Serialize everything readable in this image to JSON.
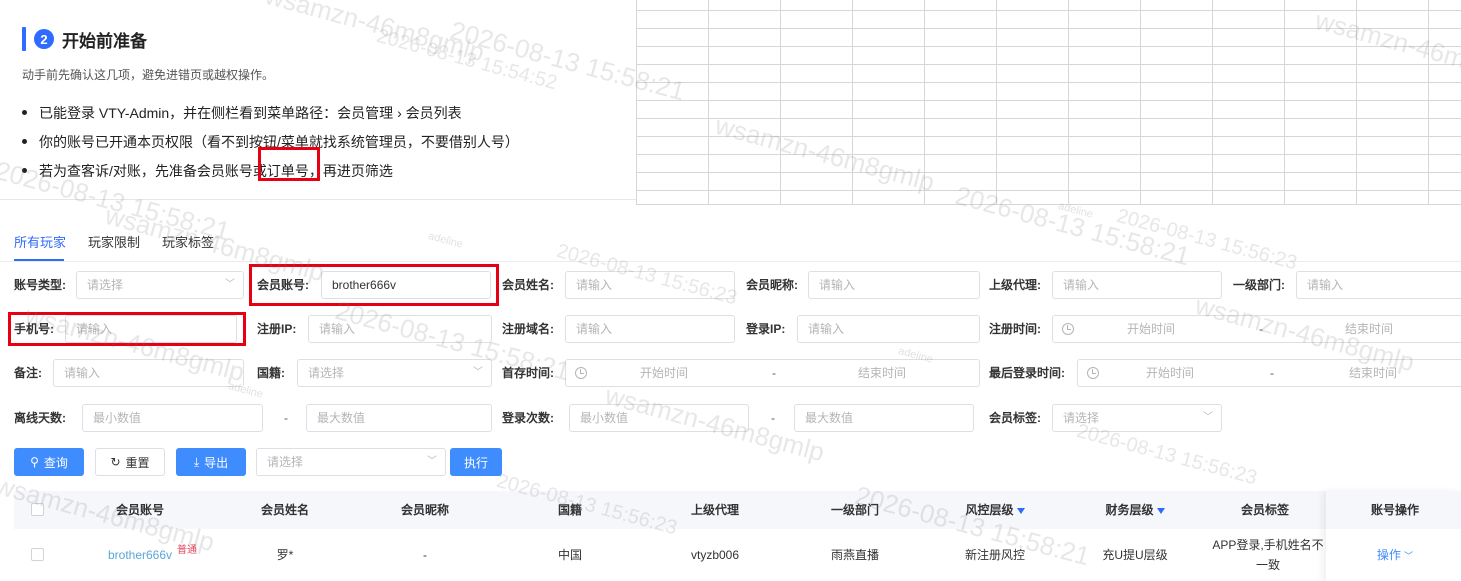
{
  "doc": {
    "step_number": "2",
    "title": "开始前准备",
    "subtitle": "动手前先确认这几项，避免进错页或越权操作。",
    "bullets": [
      "已能登录 VTY-Admin，并在侧栏看到菜单路径：会员管理 › 会员列表",
      "你的账号已开通本页权限（看不到按钮/菜单就找系统管理员，不要借别人号）",
      "若为查客诉/对账，先准备会员账号或订单号，再进页筛选"
    ]
  },
  "tabs": [
    "所有玩家",
    "玩家限制",
    "玩家标签"
  ],
  "filters": {
    "account_type": {
      "label": "账号类型:",
      "placeholder": "请选择"
    },
    "member_account": {
      "label": "会员账号:",
      "value": "brother666v"
    },
    "member_name": {
      "label": "会员姓名:",
      "placeholder": "请输入"
    },
    "member_nickname": {
      "label": "会员昵称:",
      "placeholder": "请输入"
    },
    "superior_agent": {
      "label": "上级代理:",
      "placeholder": "请输入"
    },
    "first_dept": {
      "label": "一级部门:",
      "placeholder": "请输入"
    },
    "phone": {
      "label": "手机号:",
      "placeholder": "请输入"
    },
    "register_ip": {
      "label": "注册IP:",
      "placeholder": "请输入"
    },
    "register_domain": {
      "label": "注册域名:",
      "placeholder": "请输入"
    },
    "login_ip": {
      "label": "登录IP:",
      "placeholder": "请输入"
    },
    "register_time": {
      "label": "注册时间:",
      "start": "开始时间",
      "end": "结束时间"
    },
    "remark": {
      "label": "备注:",
      "placeholder": "请输入"
    },
    "nationality": {
      "label": "国籍:",
      "placeholder": "请选择"
    },
    "first_deposit_time": {
      "label": "首存时间:",
      "start": "开始时间",
      "end": "结束时间"
    },
    "last_login_time": {
      "label": "最后登录时间:",
      "start": "开始时间",
      "end": "结束时间"
    },
    "offline_days": {
      "label": "离线天数:",
      "min": "最小数值",
      "max": "最大数值"
    },
    "login_count": {
      "label": "登录次数:",
      "min": "最小数值",
      "max": "最大数值"
    },
    "member_tags": {
      "label": "会员标签:",
      "placeholder": "请选择"
    },
    "range_sep": "-"
  },
  "actions": {
    "query": "查询",
    "reset": "重置",
    "export": "导出",
    "batch_placeholder": "请选择",
    "execute": "执行"
  },
  "table": {
    "headers": [
      "会员账号",
      "会员姓名",
      "会员昵称",
      "国籍",
      "上级代理",
      "一级部门",
      "风控层级",
      "财务层级",
      "会员标签",
      "账号操作"
    ],
    "rows": [
      {
        "account": "brother666v",
        "level_badge": "普通",
        "name": "罗*",
        "nickname": "-",
        "nationality": "中国",
        "agent": "vtyzb006",
        "dept": "雨燕直播",
        "risk_level": "新注册风控",
        "finance_level": "充U提U层级",
        "tags_line1": "APP登录,手机姓名不",
        "tags_line2": "一致",
        "op": "操作"
      }
    ]
  },
  "watermark": {
    "text": "wsamzn-46m8gmlp",
    "date": "2026-08-13 15:58:21",
    "date2": "2026-08-13 15:54:52",
    "date3": "2026-08-13 15:56:23",
    "user": "adeline"
  },
  "colors": {
    "accent": "#2f6bff",
    "highlight": "#e60012",
    "link": "#5aa7d6",
    "badge": "#e0455b"
  }
}
